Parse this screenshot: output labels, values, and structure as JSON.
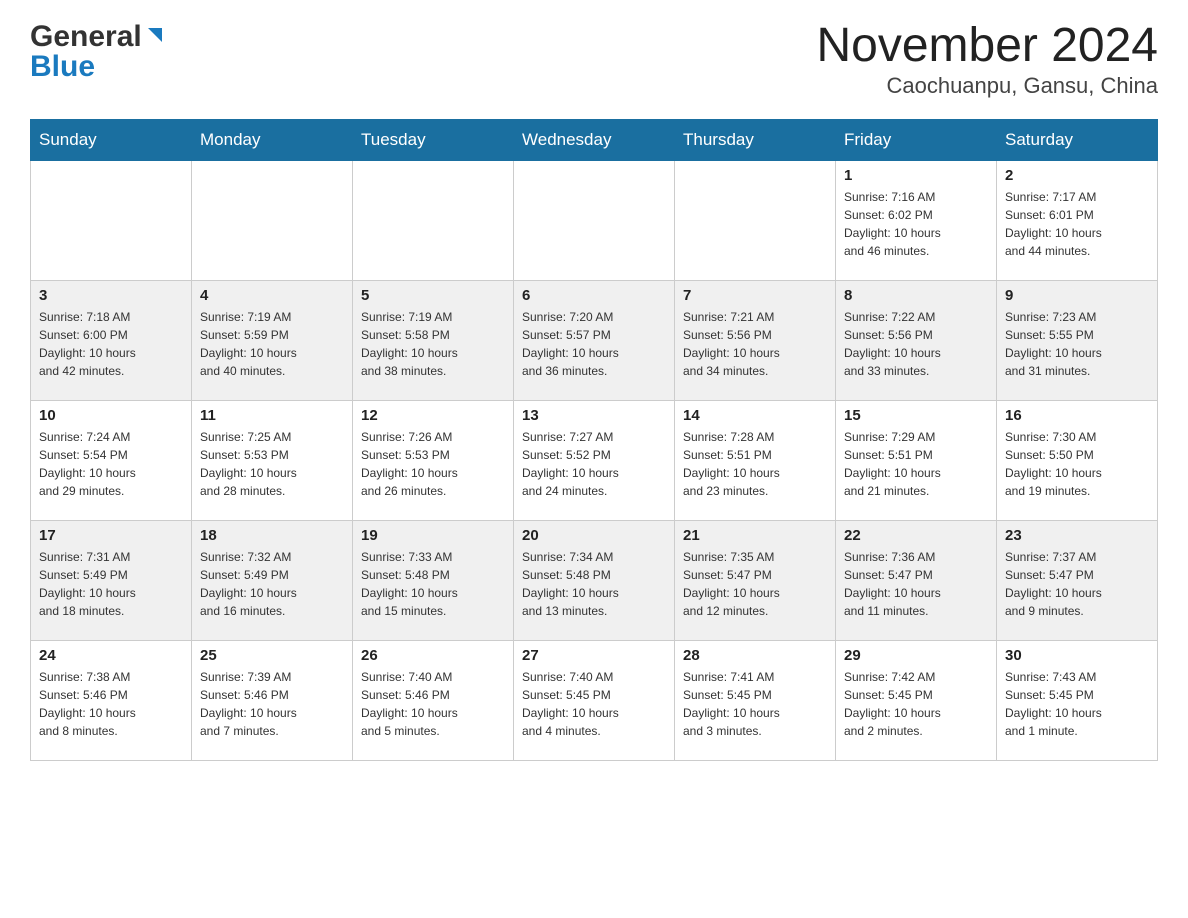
{
  "logo": {
    "general": "General",
    "blue": "Blue",
    "triangle_color": "#1a7abf"
  },
  "title": {
    "main": "November 2024",
    "sub": "Caochuanpu, Gansu, China"
  },
  "weekdays": [
    "Sunday",
    "Monday",
    "Tuesday",
    "Wednesday",
    "Thursday",
    "Friday",
    "Saturday"
  ],
  "weeks": [
    {
      "days": [
        {
          "num": "",
          "info": ""
        },
        {
          "num": "",
          "info": ""
        },
        {
          "num": "",
          "info": ""
        },
        {
          "num": "",
          "info": ""
        },
        {
          "num": "",
          "info": ""
        },
        {
          "num": "1",
          "info": "Sunrise: 7:16 AM\nSunset: 6:02 PM\nDaylight: 10 hours\nand 46 minutes."
        },
        {
          "num": "2",
          "info": "Sunrise: 7:17 AM\nSunset: 6:01 PM\nDaylight: 10 hours\nand 44 minutes."
        }
      ]
    },
    {
      "days": [
        {
          "num": "3",
          "info": "Sunrise: 7:18 AM\nSunset: 6:00 PM\nDaylight: 10 hours\nand 42 minutes."
        },
        {
          "num": "4",
          "info": "Sunrise: 7:19 AM\nSunset: 5:59 PM\nDaylight: 10 hours\nand 40 minutes."
        },
        {
          "num": "5",
          "info": "Sunrise: 7:19 AM\nSunset: 5:58 PM\nDaylight: 10 hours\nand 38 minutes."
        },
        {
          "num": "6",
          "info": "Sunrise: 7:20 AM\nSunset: 5:57 PM\nDaylight: 10 hours\nand 36 minutes."
        },
        {
          "num": "7",
          "info": "Sunrise: 7:21 AM\nSunset: 5:56 PM\nDaylight: 10 hours\nand 34 minutes."
        },
        {
          "num": "8",
          "info": "Sunrise: 7:22 AM\nSunset: 5:56 PM\nDaylight: 10 hours\nand 33 minutes."
        },
        {
          "num": "9",
          "info": "Sunrise: 7:23 AM\nSunset: 5:55 PM\nDaylight: 10 hours\nand 31 minutes."
        }
      ]
    },
    {
      "days": [
        {
          "num": "10",
          "info": "Sunrise: 7:24 AM\nSunset: 5:54 PM\nDaylight: 10 hours\nand 29 minutes."
        },
        {
          "num": "11",
          "info": "Sunrise: 7:25 AM\nSunset: 5:53 PM\nDaylight: 10 hours\nand 28 minutes."
        },
        {
          "num": "12",
          "info": "Sunrise: 7:26 AM\nSunset: 5:53 PM\nDaylight: 10 hours\nand 26 minutes."
        },
        {
          "num": "13",
          "info": "Sunrise: 7:27 AM\nSunset: 5:52 PM\nDaylight: 10 hours\nand 24 minutes."
        },
        {
          "num": "14",
          "info": "Sunrise: 7:28 AM\nSunset: 5:51 PM\nDaylight: 10 hours\nand 23 minutes."
        },
        {
          "num": "15",
          "info": "Sunrise: 7:29 AM\nSunset: 5:51 PM\nDaylight: 10 hours\nand 21 minutes."
        },
        {
          "num": "16",
          "info": "Sunrise: 7:30 AM\nSunset: 5:50 PM\nDaylight: 10 hours\nand 19 minutes."
        }
      ]
    },
    {
      "days": [
        {
          "num": "17",
          "info": "Sunrise: 7:31 AM\nSunset: 5:49 PM\nDaylight: 10 hours\nand 18 minutes."
        },
        {
          "num": "18",
          "info": "Sunrise: 7:32 AM\nSunset: 5:49 PM\nDaylight: 10 hours\nand 16 minutes."
        },
        {
          "num": "19",
          "info": "Sunrise: 7:33 AM\nSunset: 5:48 PM\nDaylight: 10 hours\nand 15 minutes."
        },
        {
          "num": "20",
          "info": "Sunrise: 7:34 AM\nSunset: 5:48 PM\nDaylight: 10 hours\nand 13 minutes."
        },
        {
          "num": "21",
          "info": "Sunrise: 7:35 AM\nSunset: 5:47 PM\nDaylight: 10 hours\nand 12 minutes."
        },
        {
          "num": "22",
          "info": "Sunrise: 7:36 AM\nSunset: 5:47 PM\nDaylight: 10 hours\nand 11 minutes."
        },
        {
          "num": "23",
          "info": "Sunrise: 7:37 AM\nSunset: 5:47 PM\nDaylight: 10 hours\nand 9 minutes."
        }
      ]
    },
    {
      "days": [
        {
          "num": "24",
          "info": "Sunrise: 7:38 AM\nSunset: 5:46 PM\nDaylight: 10 hours\nand 8 minutes."
        },
        {
          "num": "25",
          "info": "Sunrise: 7:39 AM\nSunset: 5:46 PM\nDaylight: 10 hours\nand 7 minutes."
        },
        {
          "num": "26",
          "info": "Sunrise: 7:40 AM\nSunset: 5:46 PM\nDaylight: 10 hours\nand 5 minutes."
        },
        {
          "num": "27",
          "info": "Sunrise: 7:40 AM\nSunset: 5:45 PM\nDaylight: 10 hours\nand 4 minutes."
        },
        {
          "num": "28",
          "info": "Sunrise: 7:41 AM\nSunset: 5:45 PM\nDaylight: 10 hours\nand 3 minutes."
        },
        {
          "num": "29",
          "info": "Sunrise: 7:42 AM\nSunset: 5:45 PM\nDaylight: 10 hours\nand 2 minutes."
        },
        {
          "num": "30",
          "info": "Sunrise: 7:43 AM\nSunset: 5:45 PM\nDaylight: 10 hours\nand 1 minute."
        }
      ]
    }
  ]
}
